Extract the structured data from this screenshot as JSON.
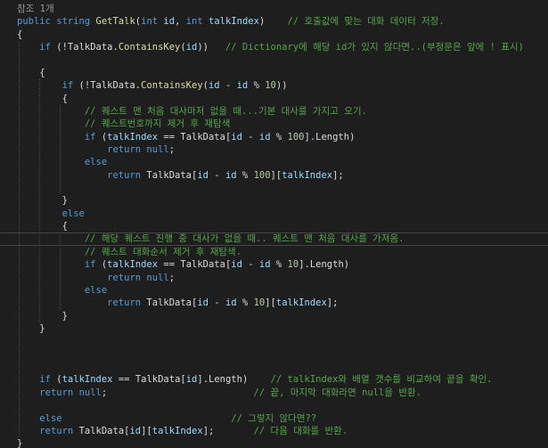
{
  "editor": {
    "background": "#1e1e1e",
    "colors": {
      "keyword": "#569cd6",
      "type": "#4ec9b0",
      "method": "#dcdcaa",
      "parameter": "#9cdcfe",
      "comment": "#57a64a",
      "number": "#b5cea8",
      "plain": "#dcdcdc",
      "codelens": "#999999"
    },
    "codelens": "참조 1개",
    "lines": [
      {
        "tokens": [
          [
            "public",
            "kw"
          ],
          [
            " ",
            "pl"
          ],
          [
            "string",
            "kw"
          ],
          [
            " ",
            "pl"
          ],
          [
            "GetTalk",
            "mt"
          ],
          [
            "(",
            "pl"
          ],
          [
            "int",
            "kw"
          ],
          [
            " ",
            "pl"
          ],
          [
            "id",
            "pm"
          ],
          [
            ", ",
            "pl"
          ],
          [
            "int",
            "kw"
          ],
          [
            " ",
            "pl"
          ],
          [
            "talkIndex",
            "pm"
          ],
          [
            ")    ",
            "pl"
          ],
          [
            "// 호출값에 맞는 대화 데이터 저장.",
            "cm"
          ]
        ]
      },
      {
        "tokens": [
          [
            "{",
            "pl"
          ]
        ]
      },
      {
        "tokens": [
          [
            "    ",
            "pl"
          ],
          [
            "if",
            "kw"
          ],
          [
            " (!",
            "pl"
          ],
          [
            "TalkData",
            "pl"
          ],
          [
            ".",
            "pl"
          ],
          [
            "ContainsKey",
            "mt"
          ],
          [
            "(",
            "pl"
          ],
          [
            "id",
            "pm"
          ],
          [
            "))   ",
            "pl"
          ],
          [
            "// Dictionary에 해당 id가 있지 않다면..(부정문은 앞에 ! 표시)",
            "cm"
          ]
        ]
      },
      {
        "tokens": []
      },
      {
        "tokens": [
          [
            "    ",
            "pl"
          ],
          [
            "{",
            "pl"
          ]
        ]
      },
      {
        "tokens": [
          [
            "        ",
            "pl"
          ],
          [
            "if",
            "kw"
          ],
          [
            " (!",
            "pl"
          ],
          [
            "TalkData",
            "pl"
          ],
          [
            ".",
            "pl"
          ],
          [
            "ContainsKey",
            "mt"
          ],
          [
            "(",
            "pl"
          ],
          [
            "id",
            "pm"
          ],
          [
            " - ",
            "pl"
          ],
          [
            "id",
            "pm"
          ],
          [
            " % ",
            "pl"
          ],
          [
            "10",
            "nm"
          ],
          [
            "))",
            "pl"
          ]
        ]
      },
      {
        "tokens": [
          [
            "        ",
            "pl"
          ],
          [
            "{",
            "pl"
          ]
        ]
      },
      {
        "tokens": [
          [
            "            ",
            "pl"
          ],
          [
            "// 퀘스트 맨 처음 대사마저 없을 때...기본 대사를 가지고 오기.",
            "cm"
          ]
        ]
      },
      {
        "tokens": [
          [
            "            ",
            "pl"
          ],
          [
            "// 퀘스트번호까지 제거 후 재탐색",
            "cm"
          ]
        ]
      },
      {
        "tokens": [
          [
            "            ",
            "pl"
          ],
          [
            "if",
            "kw"
          ],
          [
            " (",
            "pl"
          ],
          [
            "talkIndex",
            "pm"
          ],
          [
            " == ",
            "pl"
          ],
          [
            "TalkData",
            "pl"
          ],
          [
            "[",
            "pl"
          ],
          [
            "id",
            "pm"
          ],
          [
            " - ",
            "pl"
          ],
          [
            "id",
            "pm"
          ],
          [
            " % ",
            "pl"
          ],
          [
            "100",
            "nm"
          ],
          [
            "].Length)",
            "pl"
          ]
        ]
      },
      {
        "tokens": [
          [
            "                ",
            "pl"
          ],
          [
            "return",
            "kw"
          ],
          [
            " ",
            "pl"
          ],
          [
            "null",
            "kw"
          ],
          [
            ";",
            "pl"
          ]
        ]
      },
      {
        "tokens": [
          [
            "            ",
            "pl"
          ],
          [
            "else",
            "kw"
          ]
        ]
      },
      {
        "tokens": [
          [
            "                ",
            "pl"
          ],
          [
            "return",
            "kw"
          ],
          [
            " ",
            "pl"
          ],
          [
            "TalkData",
            "pl"
          ],
          [
            "[",
            "pl"
          ],
          [
            "id",
            "pm"
          ],
          [
            " - ",
            "pl"
          ],
          [
            "id",
            "pm"
          ],
          [
            " % ",
            "pl"
          ],
          [
            "100",
            "nm"
          ],
          [
            "][",
            "pl"
          ],
          [
            "talkIndex",
            "pm"
          ],
          [
            "];",
            "pl"
          ]
        ]
      },
      {
        "tokens": []
      },
      {
        "tokens": [
          [
            "        ",
            "pl"
          ],
          [
            "}",
            "pl"
          ]
        ]
      },
      {
        "tokens": [
          [
            "        ",
            "pl"
          ],
          [
            "else",
            "kw"
          ]
        ]
      },
      {
        "tokens": [
          [
            "        ",
            "pl"
          ],
          [
            "{",
            "pl"
          ]
        ]
      },
      {
        "current": true,
        "tokens": [
          [
            "            ",
            "pl"
          ],
          [
            "// 해당 퀘스트 진행 중 대사가 없을 때.. 퀘스트 맨 처음 대사를 가져옴.",
            "cm"
          ]
        ]
      },
      {
        "tokens": [
          [
            "            ",
            "pl"
          ],
          [
            "// 퀘스트 대화순서 제거 후 재탐색.",
            "cm"
          ]
        ]
      },
      {
        "tokens": [
          [
            "            ",
            "pl"
          ],
          [
            "if",
            "kw"
          ],
          [
            " (",
            "pl"
          ],
          [
            "talkIndex",
            "pm"
          ],
          [
            " == ",
            "pl"
          ],
          [
            "TalkData",
            "pl"
          ],
          [
            "[",
            "pl"
          ],
          [
            "id",
            "pm"
          ],
          [
            " - ",
            "pl"
          ],
          [
            "id",
            "pm"
          ],
          [
            " % ",
            "pl"
          ],
          [
            "10",
            "nm"
          ],
          [
            "].Length)",
            "pl"
          ]
        ]
      },
      {
        "tokens": [
          [
            "                ",
            "pl"
          ],
          [
            "return",
            "kw"
          ],
          [
            " ",
            "pl"
          ],
          [
            "null",
            "kw"
          ],
          [
            ";",
            "pl"
          ]
        ]
      },
      {
        "tokens": [
          [
            "            ",
            "pl"
          ],
          [
            "else",
            "kw"
          ]
        ]
      },
      {
        "tokens": [
          [
            "                ",
            "pl"
          ],
          [
            "return",
            "kw"
          ],
          [
            " ",
            "pl"
          ],
          [
            "TalkData",
            "pl"
          ],
          [
            "[",
            "pl"
          ],
          [
            "id",
            "pm"
          ],
          [
            " - ",
            "pl"
          ],
          [
            "id",
            "pm"
          ],
          [
            " % ",
            "pl"
          ],
          [
            "10",
            "nm"
          ],
          [
            "][",
            "pl"
          ],
          [
            "talkIndex",
            "pm"
          ],
          [
            "];",
            "pl"
          ]
        ]
      },
      {
        "tokens": [
          [
            "        ",
            "pl"
          ],
          [
            "}",
            "pl"
          ]
        ]
      },
      {
        "tokens": [
          [
            "    ",
            "pl"
          ],
          [
            "}",
            "pl"
          ]
        ]
      },
      {
        "tokens": []
      },
      {
        "tokens": []
      },
      {
        "tokens": []
      },
      {
        "tokens": [
          [
            "    ",
            "pl"
          ],
          [
            "if",
            "kw"
          ],
          [
            " (",
            "pl"
          ],
          [
            "talkIndex",
            "pm"
          ],
          [
            " == ",
            "pl"
          ],
          [
            "TalkData",
            "pl"
          ],
          [
            "[",
            "pl"
          ],
          [
            "id",
            "pm"
          ],
          [
            "].Length)    ",
            "pl"
          ],
          [
            "// talkIndex와 배열 갯수를 비교하여 끝을 확인.",
            "cm"
          ]
        ]
      },
      {
        "tokens": [
          [
            "    ",
            "pl"
          ],
          [
            "return",
            "kw"
          ],
          [
            " ",
            "pl"
          ],
          [
            "null",
            "kw"
          ],
          [
            ";                          ",
            "pl"
          ],
          [
            "// 끝, 마지막 대화라면 null을 반환.",
            "cm"
          ]
        ]
      },
      {
        "tokens": []
      },
      {
        "tokens": [
          [
            "    ",
            "pl"
          ],
          [
            "else",
            "kw"
          ],
          [
            "                              ",
            "pl"
          ],
          [
            "// 그렇지 않다면??",
            "cm"
          ]
        ]
      },
      {
        "tokens": [
          [
            "    ",
            "pl"
          ],
          [
            "return",
            "kw"
          ],
          [
            " ",
            "pl"
          ],
          [
            "TalkData",
            "pl"
          ],
          [
            "[",
            "pl"
          ],
          [
            "id",
            "pm"
          ],
          [
            "][",
            "pl"
          ],
          [
            "talkIndex",
            "pm"
          ],
          [
            "];       ",
            "pl"
          ],
          [
            "// 다음 대화를 반환.",
            "cm"
          ]
        ]
      },
      {
        "tokens": [
          [
            "}",
            "pl"
          ]
        ]
      }
    ]
  }
}
